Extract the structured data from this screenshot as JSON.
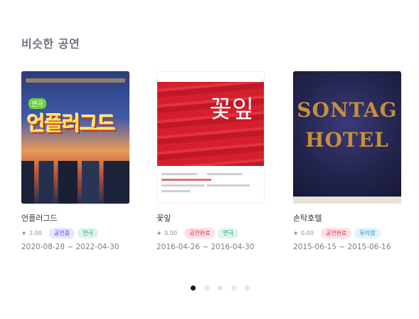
{
  "section_title": "비슷한 공연",
  "cards": [
    {
      "title": "언플러그드",
      "rating": "2.00",
      "status": "공연중",
      "genre": "연극",
      "period": "2020-08-28 ~ 2022-04-30",
      "poster_text": "언플러그드"
    },
    {
      "title": "꽃잎",
      "rating": "0.00",
      "status": "공연완료",
      "genre": "연극",
      "period": "2016-04-26 ~ 2016-04-30",
      "poster_text": "꽃잎"
    },
    {
      "title": "손탁호텔",
      "rating": "0.00",
      "status": "공연완료",
      "genre": "뮤지컬",
      "period": "2015-06-15 ~ 2015-06-16",
      "poster_text_1": "SONTAG",
      "poster_text_2": "HOTEL"
    }
  ],
  "pagination": {
    "total": 5,
    "active_index": 0
  },
  "icons": {
    "rating": "star-icon"
  },
  "colors": {
    "status_ongoing": "#4f57c9",
    "status_done": "#d2384d",
    "genre_play": "#2d9a66",
    "genre_musical": "#2a8fb3"
  }
}
